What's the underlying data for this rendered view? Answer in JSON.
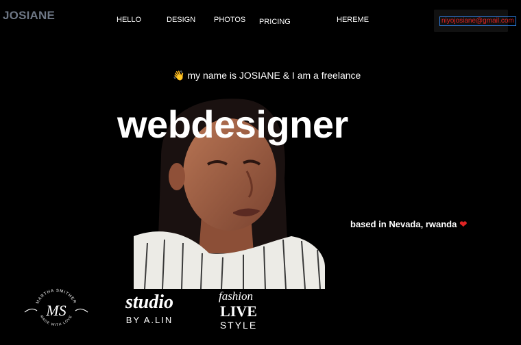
{
  "brand": {
    "name": "JOSIANE"
  },
  "nav": {
    "items": [
      {
        "label": "HELLO"
      },
      {
        "label": "DESIGN"
      },
      {
        "label": "PHOTOS"
      },
      {
        "label": "PRICING"
      },
      {
        "label": "HEREME"
      }
    ]
  },
  "contact": {
    "email": "niyojosiane@gmail.com"
  },
  "hero": {
    "intro": "my name is JOSIANE & I am a freelance",
    "wave_icon": "waving-hand-icon",
    "headline": "webdesigner",
    "location": "based in Nevada, rwanda",
    "heart_icon": "heart-icon"
  },
  "clients": [
    {
      "logo": "ms-logo",
      "ring_text": "MARTHA SMITHER",
      "initials": "MS",
      "tagline": "MADE WITH LOVE"
    },
    {
      "logo": "studio-logo",
      "script": "studio",
      "byline": "BY A.LIN"
    },
    {
      "logo": "fashion-live-style-logo",
      "script": "fashion",
      "line1": "LIVE",
      "line2": "STYLE"
    }
  ],
  "colors": {
    "background": "#000000",
    "text": "#ffffff",
    "accent": "#e02424",
    "brand": "#6d7684"
  }
}
